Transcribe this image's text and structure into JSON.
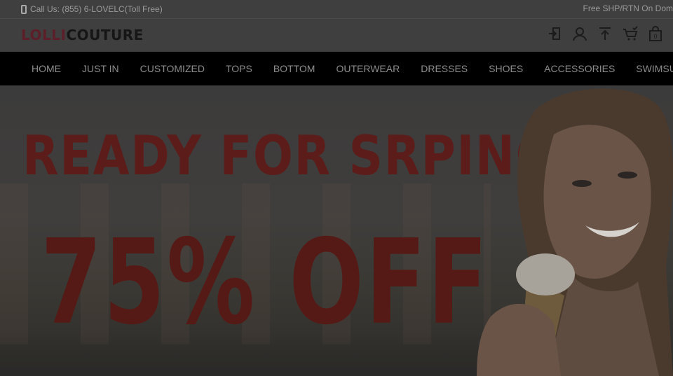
{
  "topbar": {
    "call_label": "Call Us: (855) 6-LOVELC(Toll Free)",
    "promo": "Free SHP/RTN On Dom"
  },
  "header": {
    "logo_part1": "LOLLI",
    "logo_part2": "COUTURE",
    "bag_count": "0",
    "icons": [
      "login-icon",
      "account-icon",
      "upload-icon",
      "wishlist-cart-icon",
      "shopping-bag-icon"
    ]
  },
  "nav": {
    "items": [
      "HOME",
      "JUST IN",
      "CUSTOMIZED",
      "TOPS",
      "BOTTOM",
      "OUTERWEAR",
      "DRESSES",
      "SHOES",
      "ACCESSORIES",
      "SWIMSUITS"
    ]
  },
  "hero": {
    "headline": "READY FOR SRPING",
    "offer": "75% OFF"
  },
  "colors": {
    "brand_red": "#5c1f2a",
    "nav_bg": "#000000",
    "overlay": "#2a2a2a"
  }
}
